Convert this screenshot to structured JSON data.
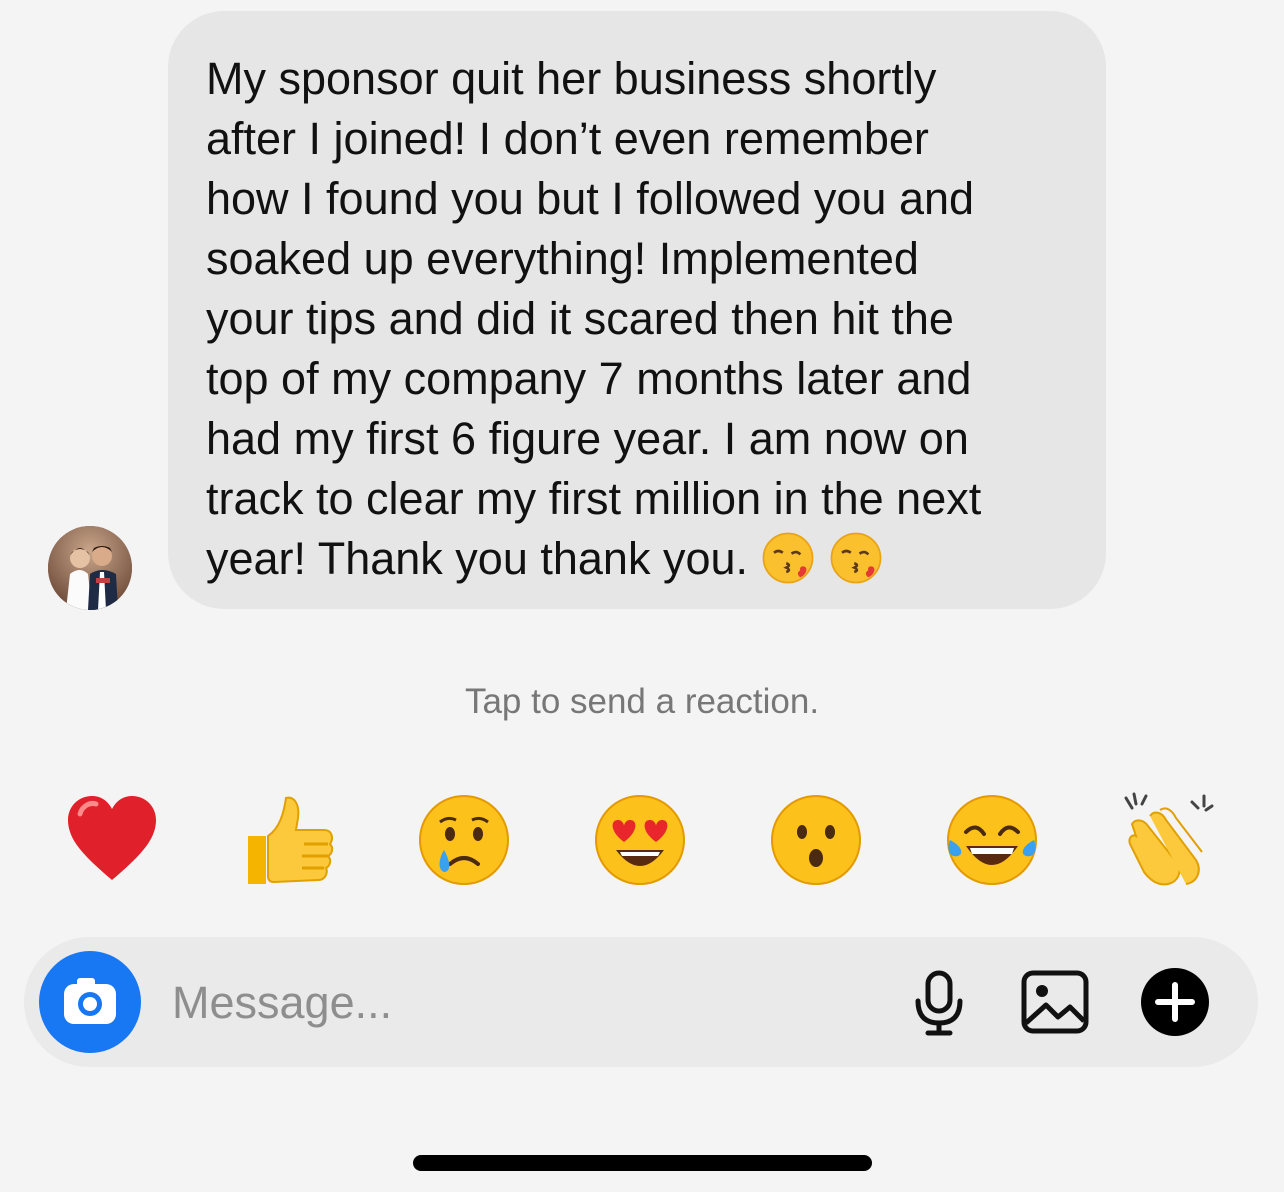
{
  "conversation": {
    "message": {
      "text": "My sponsor quit her business shortly\nafter I joined! I don’t even remember\nhow I found you but I followed you and\nsoaked up everything! Implemented\nyour tips and did it scared then hit the\ntop of my company 7 months later and\nhad my first 6 figure year. I am now on\ntrack to clear my first million in the next\nyear! Thank you thank you.",
      "trailing_emojis": [
        "face-blowing-kiss",
        "face-blowing-kiss"
      ],
      "bubble_color": "#e6e6e6"
    },
    "avatar": "profile-photo"
  },
  "reaction_hint": "Tap to send a reaction.",
  "reactions": [
    "red-heart",
    "thumbs-up",
    "crying-face",
    "heart-eyes-face",
    "surprised-face",
    "tears-of-joy-face",
    "clapping-hands"
  ],
  "composer": {
    "placeholder": "Message...",
    "camera_icon": "camera-icon",
    "camera_color": "#1877f2",
    "tools": [
      "microphone-icon",
      "image-icon",
      "plus-icon"
    ]
  }
}
